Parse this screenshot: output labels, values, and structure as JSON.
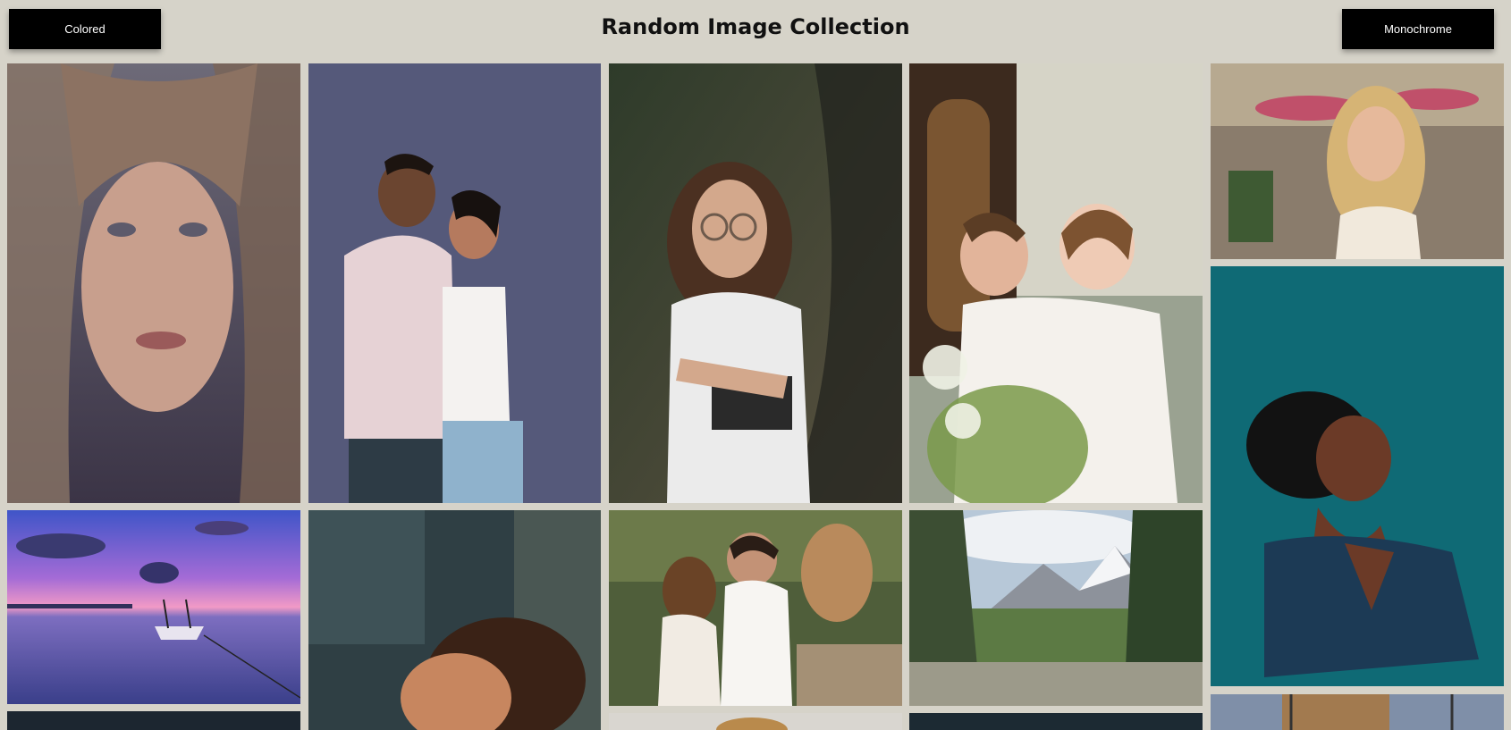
{
  "header": {
    "title": "Random Image Collection",
    "colored_label": "Colored",
    "monochrome_label": "Monochrome"
  },
  "gallery": {
    "images": [
      {
        "name": "portrait-woman-long-hair",
        "subject": "woman-portrait"
      },
      {
        "name": "couple-embrace-studio",
        "subject": "couple"
      },
      {
        "name": "girl-with-glasses",
        "subject": "girl"
      },
      {
        "name": "children-hugging",
        "subject": "children"
      },
      {
        "name": "smiling-blonde-woman-street",
        "subject": "woman-street"
      },
      {
        "name": "boat-at-sunset",
        "subject": "boat-sunset"
      },
      {
        "name": "woman-curly-hair-looking-up",
        "subject": "woman-curly"
      },
      {
        "name": "wedding-couple-bouquet",
        "subject": "wedding"
      },
      {
        "name": "mountain-valley-landscape",
        "subject": "landscape"
      },
      {
        "name": "woman-teal-background",
        "subject": "woman-teal"
      },
      {
        "name": "partial-image-bottom-left",
        "subject": "partial"
      },
      {
        "name": "partial-image-bottom-center",
        "subject": "partial"
      },
      {
        "name": "partial-image-bottom-right",
        "subject": "partial"
      },
      {
        "name": "partial-image-bottom-far-right",
        "subject": "partial"
      }
    ]
  },
  "colors": {
    "background": "#d6d3c9",
    "button": "#000000",
    "button_text": "#ffffff"
  }
}
